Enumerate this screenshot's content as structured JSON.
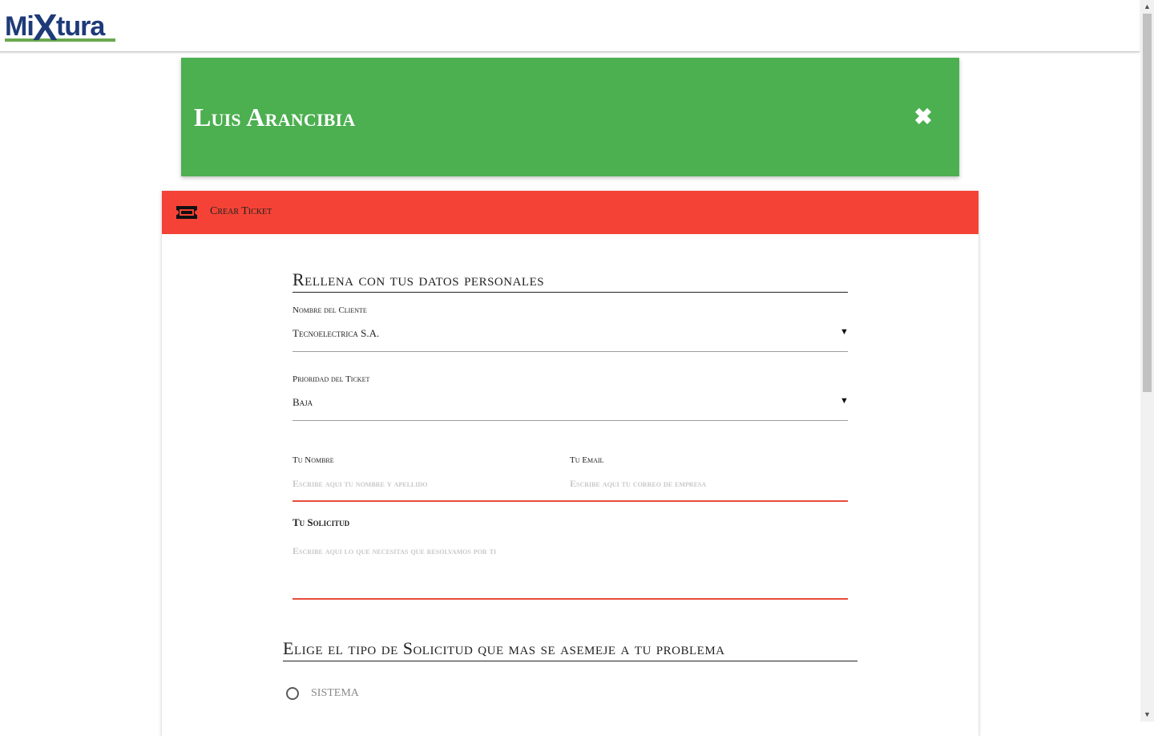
{
  "logo": {
    "text": "MiXtura",
    "icon": "mixtura-logo",
    "colors": {
      "primary": "#1e3a78",
      "accent": "#6aa84f"
    }
  },
  "profile": {
    "name": "Luis Arancibia",
    "close_icon": "close-icon",
    "color": "#4caf50"
  },
  "panel": {
    "title": "Crear Ticket",
    "icon": "ticket-icon",
    "header_color": "#f44336"
  },
  "form": {
    "section1_title": "Rellena con tus datos personales",
    "cliente": {
      "label": "Nombre del Cliente",
      "value": "Tecnoelectrica S.A."
    },
    "prioridad": {
      "label": "Prioridad del Ticket",
      "value": "Baja"
    },
    "nombre": {
      "label": "Tu Nombre",
      "placeholder": "Escribe aqui tu nombre y apellido"
    },
    "email": {
      "label": "Tu Email",
      "placeholder": "Escribe aqui tu correo de empresa"
    },
    "solicitud": {
      "label": "Tu Solicitud",
      "placeholder": "Escribe aqui lo que necesitas que resolvamos por ti"
    },
    "section2_title": "Elige el tipo de Solicitud que mas se asemeje a tu problema",
    "tipos": [
      {
        "label": "SISTEMA",
        "selected": false
      }
    ]
  }
}
